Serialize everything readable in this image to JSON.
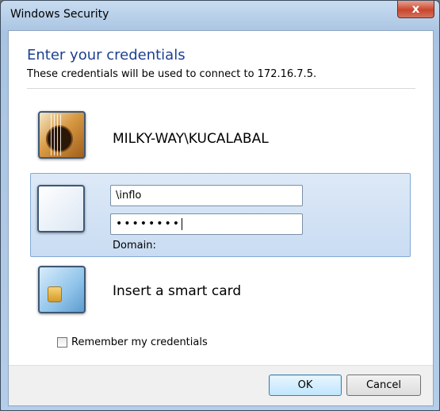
{
  "window": {
    "title": "Windows Security",
    "close_glyph": "x"
  },
  "header": {
    "heading": "Enter your credentials",
    "subtext": "These credentials will be used to connect to 172.16.7.5."
  },
  "tiles": {
    "saved_user": {
      "name": "MILKY-WAY\\KUCALABAL",
      "icon": "guitar-user-icon"
    },
    "new_user": {
      "icon": "blank-user-icon",
      "username_value": "\\inflo",
      "password_value": "••••••••",
      "domain_label": "Domain:"
    },
    "smartcard": {
      "label": "Insert a smart card",
      "icon": "smart-card-icon"
    }
  },
  "remember": {
    "label": "Remember my credentials",
    "checked": false
  },
  "buttons": {
    "ok": "OK",
    "cancel": "Cancel"
  },
  "colors": {
    "heading": "#1c3f93",
    "selected_tile": "#c9dcf2",
    "close_button": "#c9462c"
  }
}
